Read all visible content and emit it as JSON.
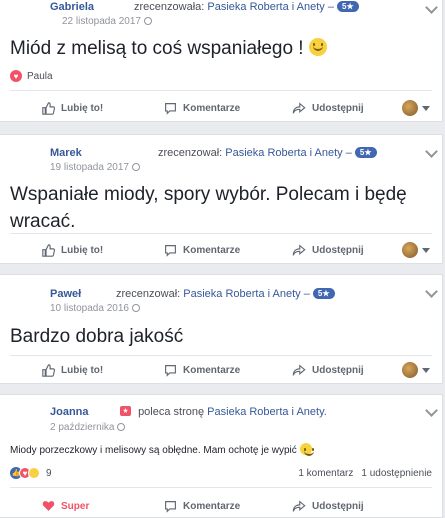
{
  "page_name": "Pasieka Roberta i Anety",
  "actions": {
    "like": "Lubię to!",
    "comment": "Komentarze",
    "share": "Udostępnij"
  },
  "colors": {
    "link": "#365899",
    "badge": "#4267b2",
    "love": "#f25268",
    "background": "#e9ebee"
  },
  "reviews": [
    {
      "author": "Gabriela",
      "verb": "zrecenzowała:",
      "page": "Pasieka Roberta i Anety –",
      "rating": "5★",
      "date": "22 listopada 2017",
      "text": "Miód z melisą to coś wspaniałego !",
      "emoji": "smile-emoji",
      "reaction_name": "Paula"
    },
    {
      "author": "Marek",
      "verb": "zrecenzował:",
      "page": "Pasieka Roberta i Anety –",
      "rating": "5★",
      "date": "19 listopada 2017",
      "text": "Wspaniałe miody, spory wybór. Polecam i będę wracać."
    },
    {
      "author": "Paweł",
      "verb": "zrecenzował:",
      "page": "Pasieka Roberta i Anety –",
      "rating": "5★",
      "date": "10 listopada 2016",
      "text": "Bardzo dobra jakość"
    },
    {
      "author": "Joanna",
      "verb": "poleca stronę",
      "page": "Pasieka Roberta i Anety.",
      "date": "2 października",
      "text": "Miody porzeczkowy i melisowy są obłędne. Mam ochotę je wypić",
      "emoji": "savoring-food-emoji",
      "reaction_count": "9",
      "comments_count": "1 komentarz",
      "shares_count": "1 udostępnienie",
      "reacted_label": "Super"
    }
  ]
}
